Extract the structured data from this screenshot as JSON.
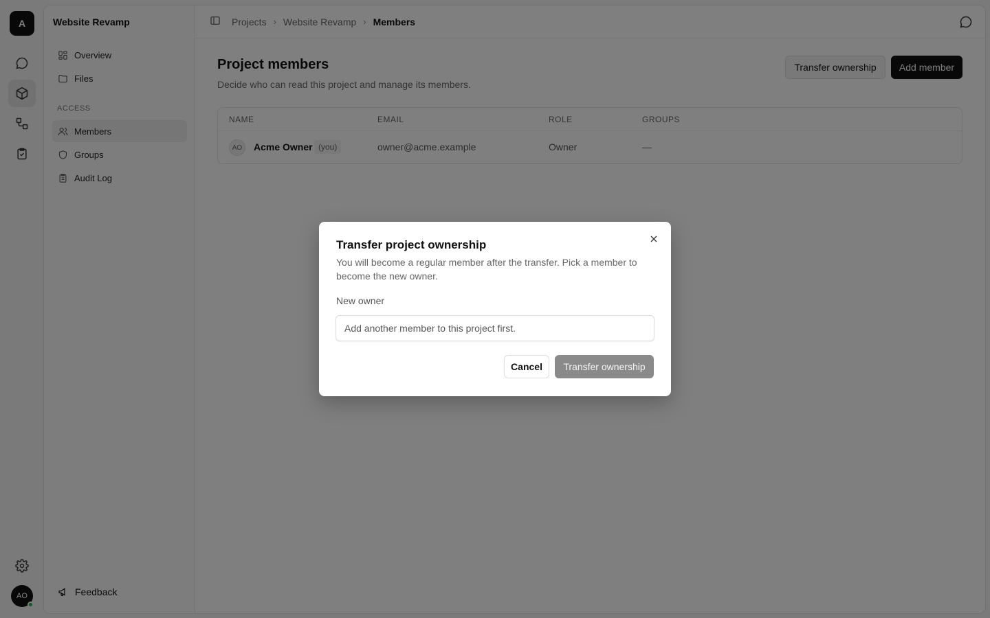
{
  "rail": {
    "logo_letter": "A",
    "user_initials": "AO"
  },
  "sidebar": {
    "project_name": "Website Revamp",
    "items": [
      {
        "label": "Overview",
        "icon": "grid-icon"
      },
      {
        "label": "Files",
        "icon": "folder-icon"
      }
    ],
    "access_label": "ACCESS",
    "access_items": [
      {
        "label": "Members",
        "icon": "users-icon",
        "active": true
      },
      {
        "label": "Groups",
        "icon": "shield-icon"
      },
      {
        "label": "Audit Log",
        "icon": "clipboard-icon"
      }
    ],
    "feedback_label": "Feedback"
  },
  "breadcrumb": [
    "Projects",
    "Website Revamp",
    "Members"
  ],
  "page": {
    "title": "Project members",
    "description": "Decide who can read this project and manage its members.",
    "transfer_button": "Transfer ownership",
    "add_button": "Add member"
  },
  "table": {
    "headers": [
      "NAME",
      "EMAIL",
      "ROLE",
      "GROUPS"
    ],
    "rows": [
      {
        "initials": "AO",
        "name": "Acme Owner",
        "badge": "(you)",
        "email": "owner@acme.example",
        "role": "Owner",
        "groups": "—"
      }
    ]
  },
  "modal": {
    "title": "Transfer project ownership",
    "description": "You will become a regular member after the transfer. Pick a member to become the new owner.",
    "label": "New owner",
    "input_placeholder": "Add another member to this project first.",
    "cancel": "Cancel",
    "confirm": "Transfer ownership"
  }
}
